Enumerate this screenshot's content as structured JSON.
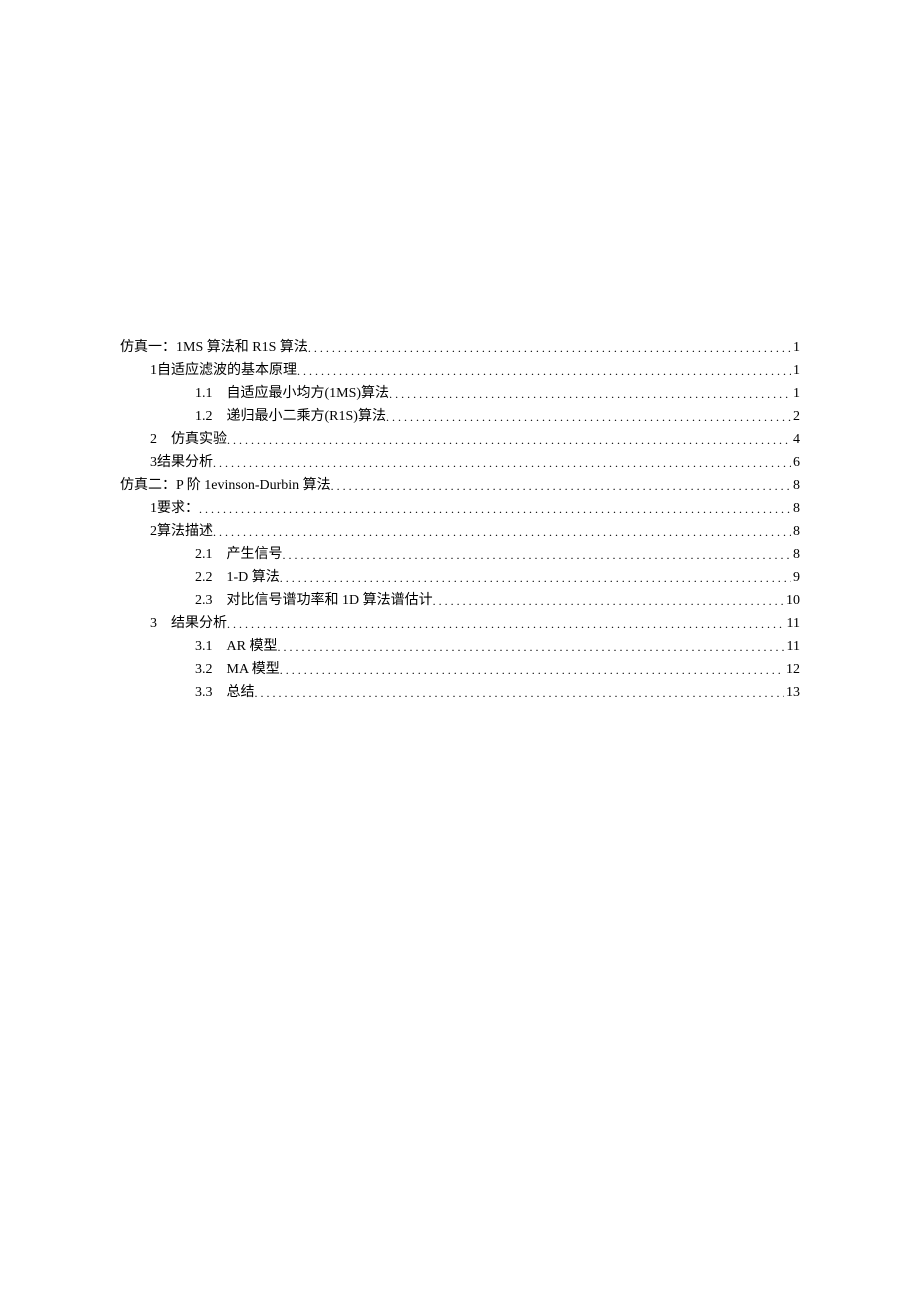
{
  "toc": [
    {
      "indent": 0,
      "num": "",
      "title": "仿真一：1MS 算法和 R1S 算法",
      "page": "1"
    },
    {
      "indent": 1,
      "num": "1",
      "title": "自适应滤波的基本原理",
      "page": "1"
    },
    {
      "indent": 2,
      "num": "1.1",
      "title": "自适应最小均方(1MS)算法",
      "page": "1"
    },
    {
      "indent": 2,
      "num": "1.2",
      "title": "递归最小二乘方(R1S)算法",
      "page": "2"
    },
    {
      "indent": 1,
      "num": "2",
      "title": "仿真实验",
      "page": "4",
      "numSpaced": true
    },
    {
      "indent": 1,
      "num": "3",
      "title": "结果分析",
      "page": "6"
    },
    {
      "indent": 0,
      "num": "",
      "title": "仿真二：P 阶 1evinson-Durbin 算法",
      "page": "8"
    },
    {
      "indent": 1,
      "num": "1",
      "title": "要求：",
      "page": "8"
    },
    {
      "indent": 1,
      "num": "2",
      "title": "算法描述",
      "page": "8"
    },
    {
      "indent": 2,
      "num": "2.1",
      "title": "产生信号",
      "page": "8"
    },
    {
      "indent": 2,
      "num": "2.2",
      "title": "1-D 算法",
      "page": "9"
    },
    {
      "indent": 2,
      "num": "2.3",
      "title": "对比信号谱功率和 1D 算法谱估计",
      "page": "10"
    },
    {
      "indent": 1,
      "num": "3",
      "title": "结果分析",
      "page": "11",
      "numSpaced": true
    },
    {
      "indent": 2,
      "num": "3.1",
      "title": "AR 模型",
      "page": "11"
    },
    {
      "indent": 2,
      "num": "3.2",
      "title": "MA 模型",
      "page": "12"
    },
    {
      "indent": 2,
      "num": "3.3",
      "title": "总结",
      "page": "13"
    }
  ]
}
